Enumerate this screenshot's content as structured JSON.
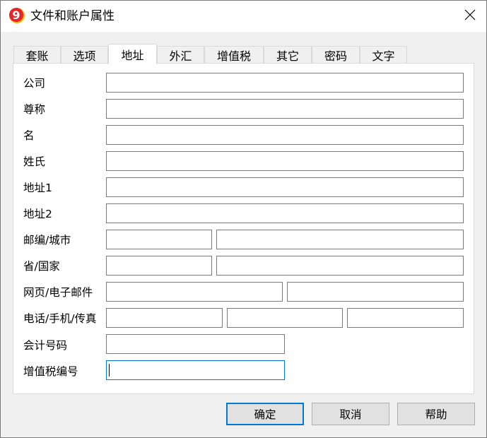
{
  "window": {
    "title": "文件和账户属性",
    "logo_glyph": "9",
    "accent_color": "#0078d7",
    "logo_colors": [
      "#e3252d",
      "#f7b500"
    ]
  },
  "tabs": [
    {
      "label": "套账",
      "active": false
    },
    {
      "label": "选项",
      "active": false
    },
    {
      "label": "地址",
      "active": true
    },
    {
      "label": "外汇",
      "active": false
    },
    {
      "label": "增值税",
      "active": false
    },
    {
      "label": "其它",
      "active": false
    },
    {
      "label": "密码",
      "active": false
    },
    {
      "label": "文字",
      "active": false
    }
  ],
  "form": {
    "company_label": "公司",
    "salutation_label": "尊称",
    "first_name_label": "名",
    "last_name_label": "姓氏",
    "address1_label": "地址1",
    "address2_label": "地址2",
    "postcode_city_label": "邮编/城市",
    "province_country_label": "省/国家",
    "web_email_label": "网页/电子邮件",
    "phone_mobile_fax_label": "电话/手机/传真",
    "accounting_number_label": "会计号码",
    "vat_number_label": "增值税编号",
    "values": {
      "company": "",
      "salutation": "",
      "first_name": "",
      "last_name": "",
      "address1": "",
      "address2": "",
      "postcode": "",
      "city": "",
      "province": "",
      "country": "",
      "web": "",
      "email": "",
      "phone": "",
      "mobile": "",
      "fax": "",
      "accounting_number": "",
      "vat_number": ""
    }
  },
  "buttons": {
    "ok": "确定",
    "cancel": "取消",
    "help": "帮助"
  }
}
